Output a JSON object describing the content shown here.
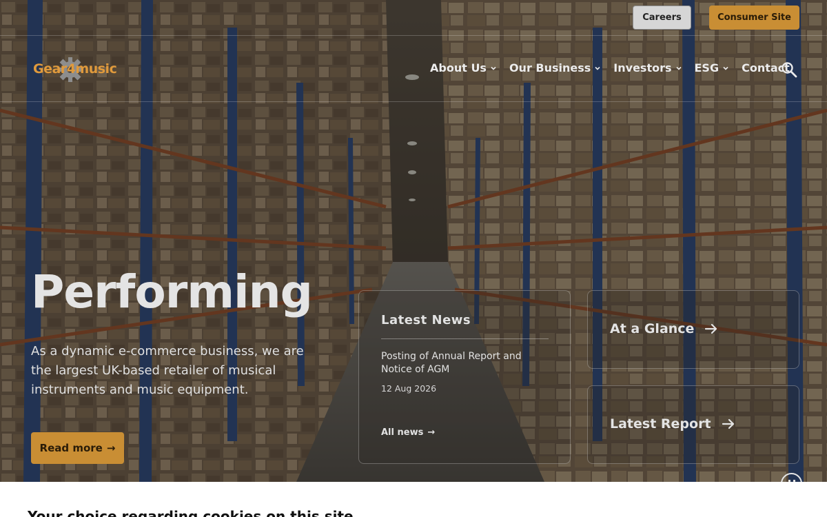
{
  "colors": {
    "accent": "#c98e34",
    "logo": "#e09a3c",
    "light_button": "#d6d6d6",
    "text_light": "#e4e4e4"
  },
  "utility": {
    "careers_label": "Careers",
    "consumer_label": "Consumer Site"
  },
  "logo": {
    "text_left": "Gear",
    "text_right": "music",
    "numeral": "4"
  },
  "nav": {
    "items": [
      {
        "label": "About Us",
        "has_dropdown": true
      },
      {
        "label": "Our Business",
        "has_dropdown": true
      },
      {
        "label": "Investors",
        "has_dropdown": true
      },
      {
        "label": "ESG",
        "has_dropdown": true
      },
      {
        "label": "Contact",
        "has_dropdown": false
      }
    ],
    "search_icon": "search-icon"
  },
  "hero": {
    "headline": "Performing",
    "intro": "As a dynamic e-commerce business, we are the largest UK-based retailer of musical instruments and music equipment.",
    "read_more_label": "Read more",
    "arrow": "→"
  },
  "news": {
    "title": "Latest News",
    "item_title": "Posting of Annual Report and Notice of AGM",
    "item_date": "12 Aug 2026",
    "all_news_label": "All news",
    "arrow": "→"
  },
  "cards": {
    "glance_label": "At a Glance",
    "report_label": "Latest Report"
  },
  "cookie": {
    "title": "Your choice regarding cookies on this site"
  }
}
